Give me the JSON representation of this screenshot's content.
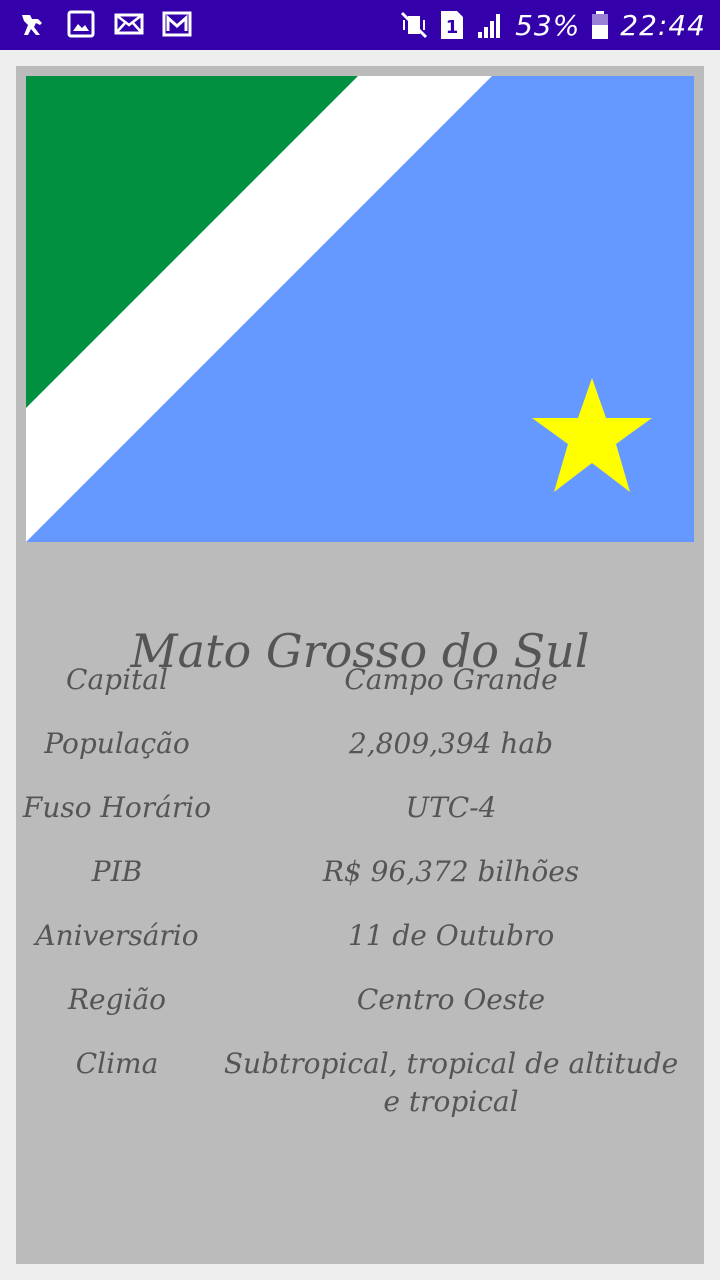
{
  "status_bar": {
    "icons_left": [
      "assistant-icon",
      "image-icon",
      "mail-icon",
      "gmail-icon"
    ],
    "icons_right": [
      "vibrate-mute-icon",
      "sim-1-icon",
      "signal-icon",
      "battery-icon"
    ],
    "battery": "53%",
    "time": "22:44"
  },
  "state": {
    "name": "Mato Grosso do Sul",
    "flag_colors": {
      "green": "#009040",
      "white": "#ffffff",
      "blue": "#6699ff",
      "star": "#ffff00"
    }
  },
  "info": [
    {
      "label": "Capital",
      "value": "Campo Grande"
    },
    {
      "label": "População",
      "value": "2,809,394 hab"
    },
    {
      "label": "Fuso Horário",
      "value": "UTC-4"
    },
    {
      "label": "PIB",
      "value": "R$ 96,372 bilhões"
    },
    {
      "label": "Aniversário",
      "value": "11 de Outubro"
    },
    {
      "label": "Região",
      "value": "Centro Oeste"
    },
    {
      "label": "Clima",
      "value_lines": [
        "Subtropical, tropical de altitude",
        "e tropical"
      ]
    }
  ]
}
